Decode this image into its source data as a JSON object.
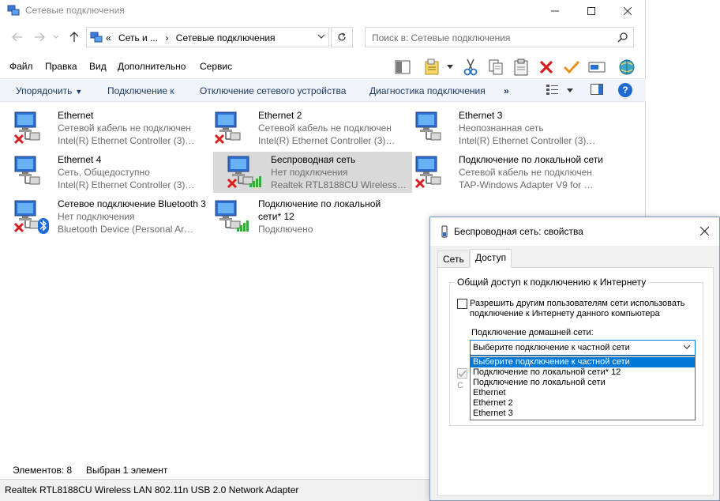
{
  "window": {
    "title": "Сетевые подключения",
    "minimize_icon": "minimize-icon",
    "maximize_icon": "maximize-icon",
    "close_icon": "close-icon"
  },
  "nav": {
    "crumb_prefix": "«",
    "crumb_1": "Сеть и ...",
    "crumb_sep": "›",
    "crumb_2": "Сетевые подключения",
    "search_placeholder": "Поиск в: Сетевые подключения"
  },
  "menu": {
    "file": "Файл",
    "edit": "Правка",
    "view": "Вид",
    "advanced": "Дополнительно",
    "service": "Сервис"
  },
  "commands": {
    "organize": "Упорядочить",
    "connect": "Подключение к",
    "disable": "Отключение сетевого устройства",
    "diagnose": "Диагностика подключения",
    "more": "»",
    "help": "?"
  },
  "connections": [
    {
      "name": "Ethernet",
      "status": "Сетевой кабель не подключен",
      "device": "Intel(R) Ethernet Controller (3) I22...",
      "icon": "network-computer-icon",
      "overlay": "disconnected-x-icon"
    },
    {
      "name": "Ethernet 2",
      "status": "Сетевой кабель не подключен",
      "device": "Intel(R) Ethernet Controller (3) I22...",
      "icon": "network-computer-icon",
      "overlay": "disconnected-x-icon"
    },
    {
      "name": "Ethernet 3",
      "status": "Неопознанная сеть",
      "device": "Intel(R) Ethernet Controller (3) I22...",
      "icon": "network-computer-icon",
      "overlay": ""
    },
    {
      "name": "Ethernet 4",
      "status": "Сеть, Общедоступно",
      "device": "Intel(R) Ethernet Controller (3) I22...",
      "icon": "network-computer-icon",
      "overlay": ""
    },
    {
      "name": "Беспроводная сеть",
      "status": "Нет подключения",
      "device": "Realtek RTL8188CU Wireless LAN ...",
      "icon": "wireless-network-icon",
      "overlay": "disconnected-x-icon"
    },
    {
      "name": "Подключение по локальной сети",
      "status": "Сетевой кабель не подключен",
      "device": "TAP-Windows Adapter V9 for Ope...",
      "icon": "network-computer-icon",
      "overlay": "disconnected-x-icon"
    },
    {
      "name": "Сетевое подключение Bluetooth 3",
      "status": "Нет подключения",
      "device": "Bluetooth Device (Personal Area ...",
      "icon": "bluetooth-network-icon",
      "overlay": "disconnected-x-icon"
    },
    {
      "name": "Подключение по локальной",
      "name2": "сети* 12",
      "status": "Подключено",
      "device": "",
      "icon": "wireless-network-icon",
      "overlay": ""
    }
  ],
  "status": {
    "items_count": "Элементов: 8",
    "selected": "Выбран 1 элемент",
    "adapter": "Realtek RTL8188CU Wireless LAN 802.11n USB 2.0 Network Adapter"
  },
  "dialog": {
    "title": "Беспроводная сеть: свойства",
    "tab_network": "Сеть",
    "tab_sharing": "Доступ",
    "group_title": "Общий доступ к подключению к Интернету",
    "allow_sharing_line1": "Разрешить другим пользователям сети использовать",
    "allow_sharing_line2": "подключение к Интернету данного компьютера",
    "home_network_label": "Подключение домашней сети:",
    "combo_value": "Выберите подключение к частной сети",
    "options": [
      "Выберите подключение к частной сети",
      "Подключение по локальной сети* 12",
      "Подключение по локальной сети",
      "Ethernet",
      "Ethernet 2",
      "Ethernet 3"
    ],
    "hidden_char": "С"
  },
  "colors": {
    "accent": "#0078d7",
    "command_bar": "#f1f5fb",
    "selected_item": "#d9d9d9",
    "error_red": "#d81e1e",
    "signal_green": "#3aa83a"
  }
}
